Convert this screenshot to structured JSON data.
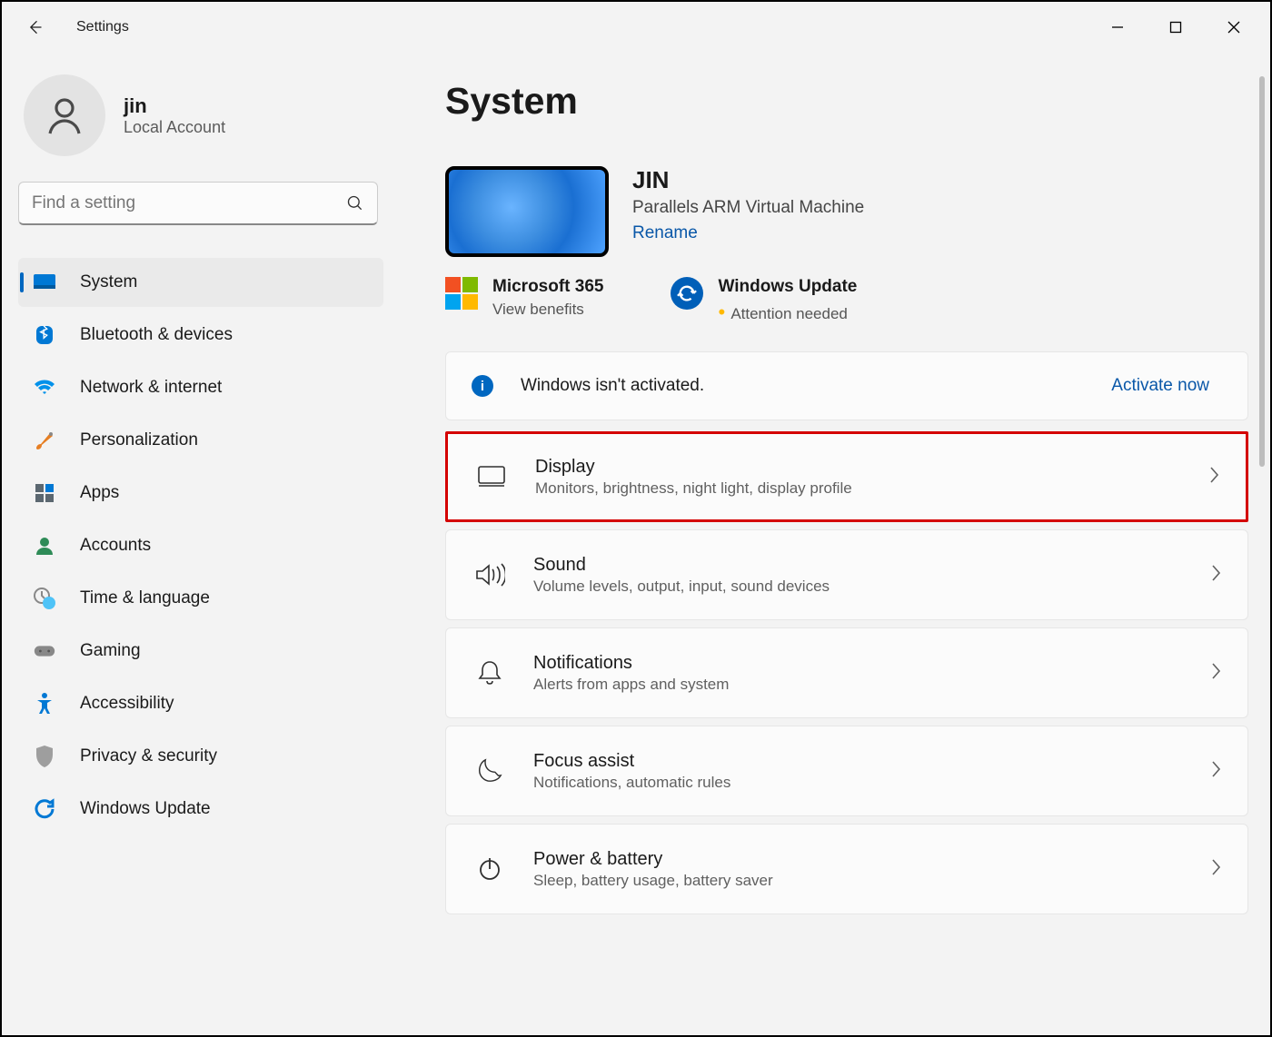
{
  "app": {
    "title": "Settings"
  },
  "user": {
    "name": "jin",
    "subtitle": "Local Account"
  },
  "search": {
    "placeholder": "Find a setting"
  },
  "nav": {
    "items": [
      {
        "label": "System"
      },
      {
        "label": "Bluetooth & devices"
      },
      {
        "label": "Network & internet"
      },
      {
        "label": "Personalization"
      },
      {
        "label": "Apps"
      },
      {
        "label": "Accounts"
      },
      {
        "label": "Time & language"
      },
      {
        "label": "Gaming"
      },
      {
        "label": "Accessibility"
      },
      {
        "label": "Privacy & security"
      },
      {
        "label": "Windows Update"
      }
    ]
  },
  "page": {
    "title": "System"
  },
  "device": {
    "name": "JIN",
    "desc": "Parallels ARM Virtual Machine",
    "rename": "Rename"
  },
  "quick": {
    "m365": {
      "title": "Microsoft 365",
      "sub": "View benefits"
    },
    "wu": {
      "title": "Windows Update",
      "sub": "Attention needed"
    }
  },
  "banner": {
    "text": "Windows isn't activated.",
    "link": "Activate now"
  },
  "cards": [
    {
      "title": "Display",
      "sub": "Monitors, brightness, night light, display profile",
      "highlight": true
    },
    {
      "title": "Sound",
      "sub": "Volume levels, output, input, sound devices"
    },
    {
      "title": "Notifications",
      "sub": "Alerts from apps and system"
    },
    {
      "title": "Focus assist",
      "sub": "Notifications, automatic rules"
    },
    {
      "title": "Power & battery",
      "sub": "Sleep, battery usage, battery saver"
    }
  ]
}
